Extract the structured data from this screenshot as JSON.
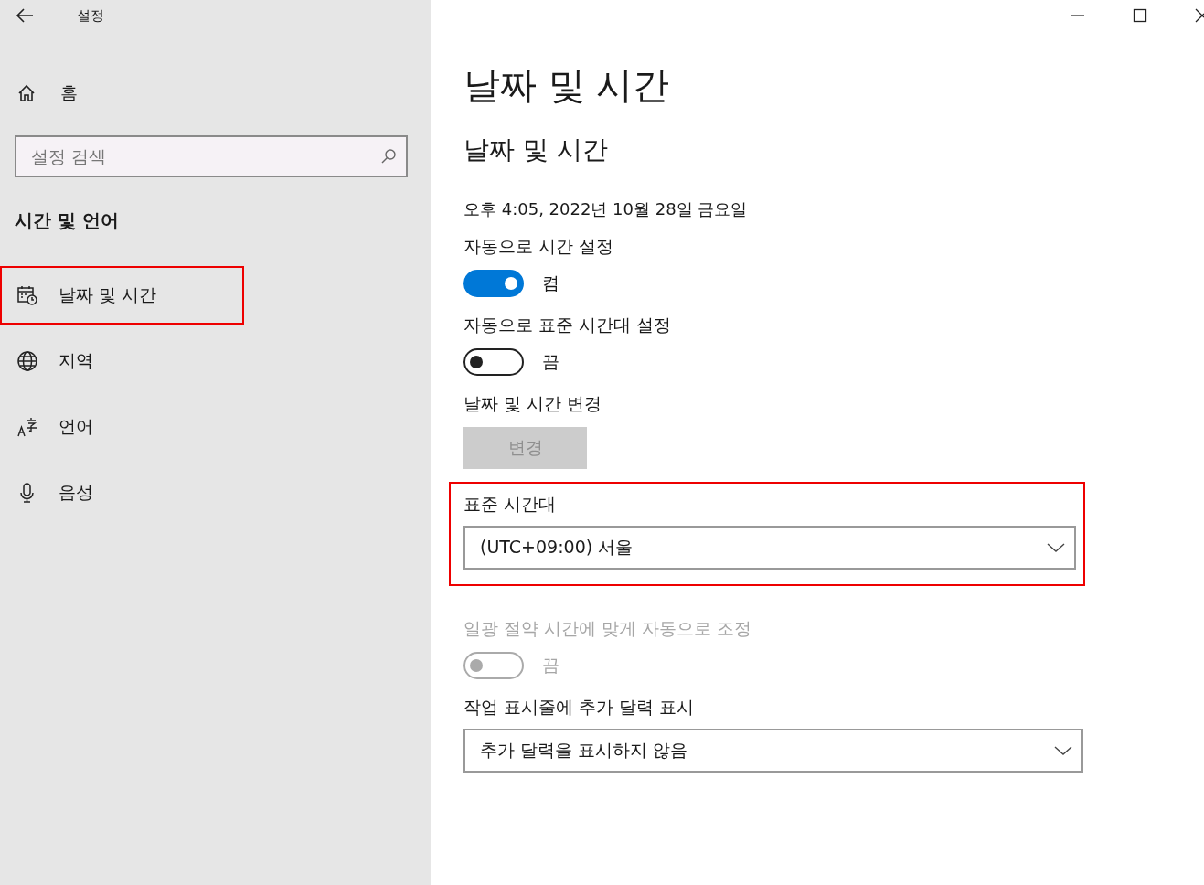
{
  "window": {
    "title": "설정"
  },
  "sidebar": {
    "home": "홈",
    "search": {
      "placeholder": "설정 검색"
    },
    "heading": "시간 및 언어",
    "items": [
      {
        "label": "날짜 및 시간",
        "kind": "datetime",
        "highlighted": true
      },
      {
        "label": "지역",
        "kind": "region",
        "highlighted": false
      },
      {
        "label": "언어",
        "kind": "language",
        "highlighted": false
      },
      {
        "label": "음성",
        "kind": "speech",
        "highlighted": false
      }
    ]
  },
  "page": {
    "title": "날짜 및 시간",
    "subtitle": "날짜 및 시간",
    "current_time": "오후 4:05, 2022년 10월 28일 금요일",
    "settings": [
      {
        "kind": "toggle",
        "label": "자동으로 시간 설정",
        "on": true,
        "state_text": "켬",
        "highlighted": false
      },
      {
        "kind": "toggle",
        "label": "자동으로 표준 시간대 설정",
        "on": false,
        "state_text": "끔",
        "highlighted": false
      },
      {
        "kind": "button",
        "label": "날짜 및 시간 변경",
        "button": "변경",
        "disabled": true,
        "highlighted": false
      },
      {
        "kind": "dropdown",
        "label": "표준 시간대",
        "value": "(UTC+09:00) 서울",
        "highlighted": true
      },
      {
        "kind": "toggle",
        "label": "일광 절약 시간에 맞게 자동으로 조정",
        "on": false,
        "disabled": true,
        "state_text": "끔",
        "highlighted": false
      },
      {
        "kind": "dropdown",
        "label": "작업 표시줄에 추가 달력 표시",
        "value": "추가 달력을 표시하지 않음",
        "highlighted": false
      }
    ]
  }
}
